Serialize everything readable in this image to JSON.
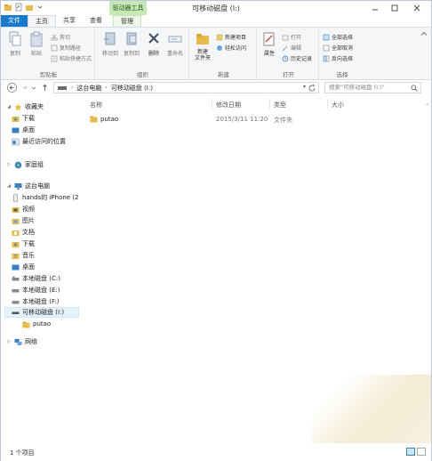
{
  "title_bar": {
    "title": "可移动磁盘 (I:)",
    "context_tab": "驱动器工具"
  },
  "ribbon_tabs": [
    {
      "label": "文件"
    },
    {
      "label": "主页"
    },
    {
      "label": "共享"
    },
    {
      "label": "查看"
    },
    {
      "label": "管理"
    }
  ],
  "ribbon": {
    "clipboard": {
      "group_label": "剪贴板",
      "copy": "复制",
      "paste": "粘贴",
      "cut": "剪切",
      "copy_path": "复制路径",
      "paste_shortcut": "粘贴快捷方式"
    },
    "organize": {
      "group_label": "组织",
      "move_to": "移动到",
      "copy_to": "复制到",
      "delete": "删除",
      "rename": "重命名"
    },
    "new": {
      "group_label": "新建",
      "new_folder": "新建\n文件夹",
      "new_item": "新建项目",
      "easy_access": "轻松访问"
    },
    "open": {
      "group_label": "打开",
      "properties": "属性",
      "open": "打开",
      "edit": "编辑",
      "history": "历史记录"
    },
    "select": {
      "group_label": "选择",
      "select_all": "全部选择",
      "select_none": "全部取消",
      "invert": "反向选择"
    }
  },
  "address": {
    "crumbs": [
      "这台电脑",
      "可移动磁盘 (I:)"
    ],
    "search_placeholder": "搜索\"可移动磁盘 (I:)\""
  },
  "nav": {
    "favorites": "收藏夹",
    "downloads": "下载",
    "desktop": "桌面",
    "recent": "最近访问的位置",
    "homegroup": "家庭组",
    "this_pc": "这台电脑",
    "iphone": "hands的 iPhone (2",
    "videos": "视频",
    "pictures": "图片",
    "documents": "文档",
    "downloads2": "下载",
    "music": "音乐",
    "desktop2": "桌面",
    "disk_c": "本地磁盘 (C:)",
    "disk_e": "本地磁盘 (E:)",
    "disk_f": "本地磁盘 (F:)",
    "removable": "可移动磁盘 (I:)",
    "putao": "putao",
    "network": "网络"
  },
  "columns": {
    "name": "名称",
    "modified": "修改日期",
    "type": "类型",
    "size": "大小"
  },
  "files": [
    {
      "name": "putao",
      "modified": "2015/3/11 11:20",
      "type": "文件夹",
      "size": ""
    }
  ],
  "status": {
    "count": "1 个项目"
  },
  "colors": {
    "file_tab": "#1979ca",
    "context_tab": "#c6e8b7",
    "selection": "#e5f1fb",
    "folder": "#e8b94b"
  }
}
